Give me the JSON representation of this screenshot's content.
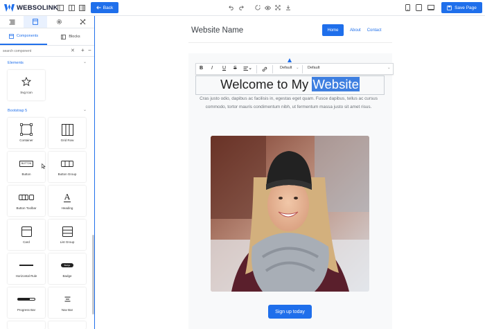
{
  "app": {
    "brand": "WEBSOLINK"
  },
  "toolbar": {
    "back_label": "Back",
    "save_label": "Save Page"
  },
  "panel": {
    "subtabs": [
      {
        "label": "Components"
      },
      {
        "label": "Blocks"
      }
    ],
    "search": {
      "placeholder": "search component"
    },
    "sections": [
      {
        "title": "Elements",
        "items": [
          {
            "label": "Svg Icon",
            "icon": "star-icon"
          }
        ]
      },
      {
        "title": "Bootstrap 5",
        "items": [
          {
            "label": "Container",
            "icon": "container-icon"
          },
          {
            "label": "Grid Row",
            "icon": "grid-row-icon"
          },
          {
            "label": "Button",
            "icon": "button-icon",
            "icon_text": "BUTTON"
          },
          {
            "label": "Button Group",
            "icon": "button-group-icon"
          },
          {
            "label": "Button Toolbar",
            "icon": "button-toolbar-icon"
          },
          {
            "label": "Heading",
            "icon": "heading-icon",
            "icon_text": "A"
          },
          {
            "label": "Card",
            "icon": "card-icon"
          },
          {
            "label": "List Group",
            "icon": "list-group-icon"
          },
          {
            "label": "Horizontal Rule",
            "icon": "horizontal-rule-icon"
          },
          {
            "label": "Badge",
            "icon": "badge-icon",
            "icon_text": "Badge"
          },
          {
            "label": "Progress Bar",
            "icon": "progress-bar-icon"
          },
          {
            "label": "Nav Bar",
            "icon": "nav-bar-icon"
          }
        ]
      }
    ]
  },
  "site": {
    "name": "Website Name",
    "nav": [
      {
        "label": "Home",
        "active": true
      },
      {
        "label": "About"
      },
      {
        "label": "Contact"
      }
    ],
    "editor": {
      "font_select": "Default",
      "size_select": "Default"
    },
    "heading_plain": "Welcome to My ",
    "heading_selected": "Website",
    "paragraph": "Cras justo odio, dapibus ac facilisis in, egestas eget quam. Fusce dapibus, tellus ac cursus commodo, tortor mauris condimentum nibh, ut fermentum massa justo sit amet risus.",
    "cta_label": "Sign up today"
  },
  "colors": {
    "accent": "#1f6feb",
    "selection": "#3e7fe0",
    "page_bg": "#f8f9fa"
  }
}
